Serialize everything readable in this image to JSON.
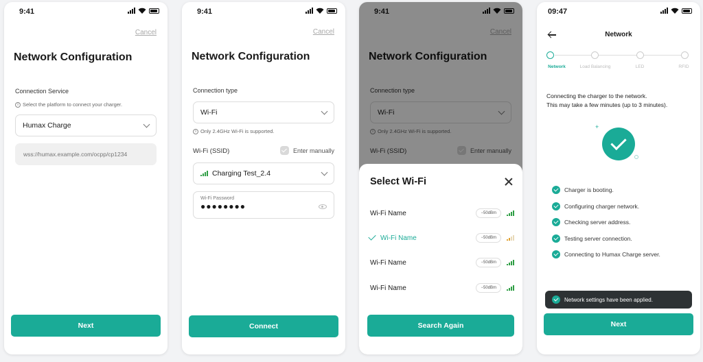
{
  "colors": {
    "accent": "#1aab97",
    "signal_good": "#2e9e44",
    "signal_weak": "#e0a030",
    "toast_bg": "#2d3234"
  },
  "screen1": {
    "time": "9:41",
    "cancel": "Cancel",
    "title": "Network Configuration",
    "service_label": "Connection Service",
    "service_hint": "Select the platform to connect your charger.",
    "service_value": "Humax Charge",
    "url_placeholder": "wss://humax.example.com/ocpp/cp1234",
    "next": "Next"
  },
  "screen2": {
    "time": "9:41",
    "cancel": "Cancel",
    "title": "Network Configuration",
    "type_label": "Connection type",
    "type_value": "Wi-Fi",
    "type_hint": "Only 2.4GHz Wi-Fi is supported.",
    "ssid_label": "Wi-Fi (SSID)",
    "enter_manually": "Enter manually",
    "ssid_value": "Charging Test_2.4",
    "password_label": "Wi-Fi Password",
    "password_value": "●●●●●●●●",
    "connect": "Connect"
  },
  "screen3": {
    "time": "9:41",
    "cancel": "Cancel",
    "title": "Network Configuration",
    "type_label": "Connection type",
    "type_value": "Wi-Fi",
    "type_hint": "Only 2.4GHz Wi-Fi is supported.",
    "ssid_label": "Wi-Fi (SSID)",
    "enter_manually": "Enter manually",
    "sheet_title": "Select Wi-Fi",
    "networks": [
      {
        "name": "Wi-Fi Name",
        "dbm": "−50dBm",
        "selected": false,
        "signal": "strong"
      },
      {
        "name": "Wi-Fi Name",
        "dbm": "−50dBm",
        "selected": true,
        "signal": "weak"
      },
      {
        "name": "Wi-Fi Name",
        "dbm": "−50dBm",
        "selected": false,
        "signal": "strong"
      },
      {
        "name": "Wi-Fi Name",
        "dbm": "−50dBm",
        "selected": false,
        "signal": "strong"
      }
    ],
    "search_again": "Search Again"
  },
  "screen4": {
    "time": "09:47",
    "header": "Network",
    "steps": [
      "Network",
      "Load Balancing",
      "LED",
      "RFID"
    ],
    "message_line1": "Connecting the charger to the network.",
    "message_line2": "This may take a few minutes (up to 3 minutes).",
    "status": [
      "Charger is booting.",
      "Configuring charger network.",
      "Checking server address.",
      "Testing server connection.",
      "Connecting to Humax Charge server."
    ],
    "toast": "Network settings have been applied.",
    "next": "Next"
  }
}
